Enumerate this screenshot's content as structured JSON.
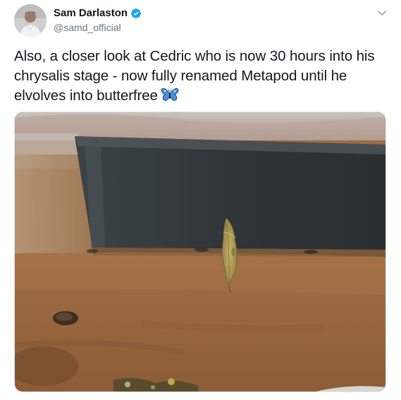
{
  "tweet": {
    "author": {
      "display_name": "Sam Darlaston",
      "handle": "@samd_official",
      "verified": true
    },
    "text_lines": [
      "Also, a closer look at Cedric who is now 30 hours into his",
      "chrysalis stage - now fully renamed Metapod until he",
      "elvolves into butterfree"
    ],
    "emoji": "butterfly-icon",
    "media": {
      "description_icon": "photo"
    }
  },
  "colors": {
    "verified_blue": "#1da1f2",
    "handle_gray": "#657786",
    "text": "#14171a",
    "butterfly_blue": "#3b82c4"
  }
}
